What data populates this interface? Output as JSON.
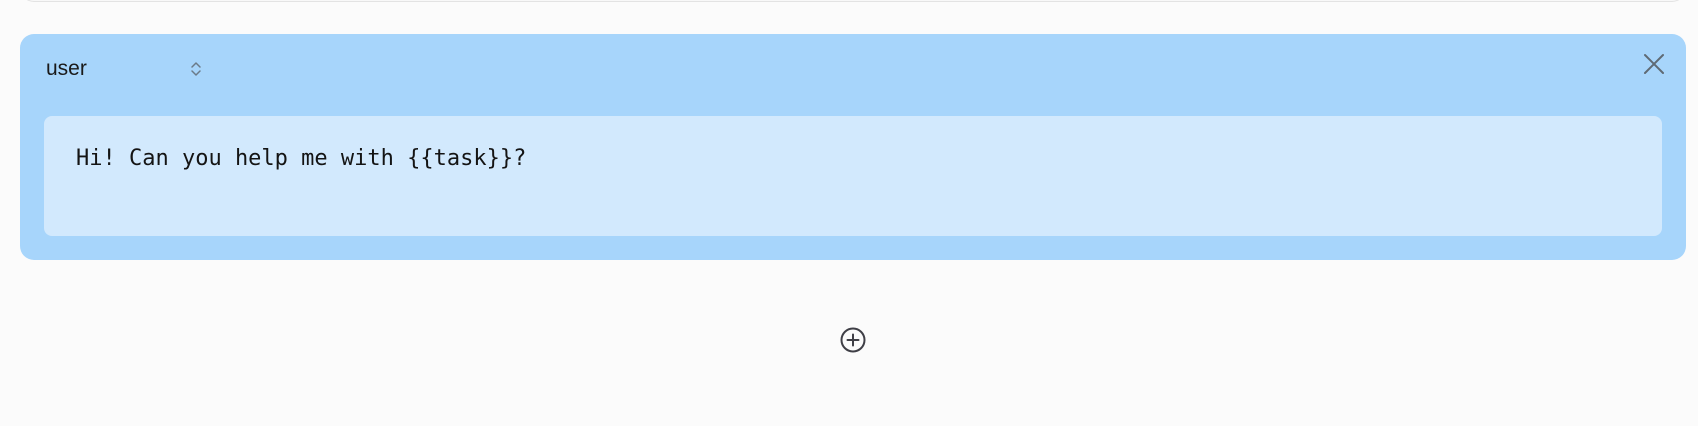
{
  "message": {
    "role": "user",
    "content": "Hi! Can you help me with {{task}}?"
  },
  "icons": {
    "role_toggle": "chevron-up-down-icon",
    "close": "close-icon",
    "add": "plus-circle-icon"
  },
  "colors": {
    "card_background": "#a7d5fb",
    "content_background": "#d2e9fd",
    "page_background": "#fbfbfb",
    "icon_color": "#5a5a5a"
  }
}
